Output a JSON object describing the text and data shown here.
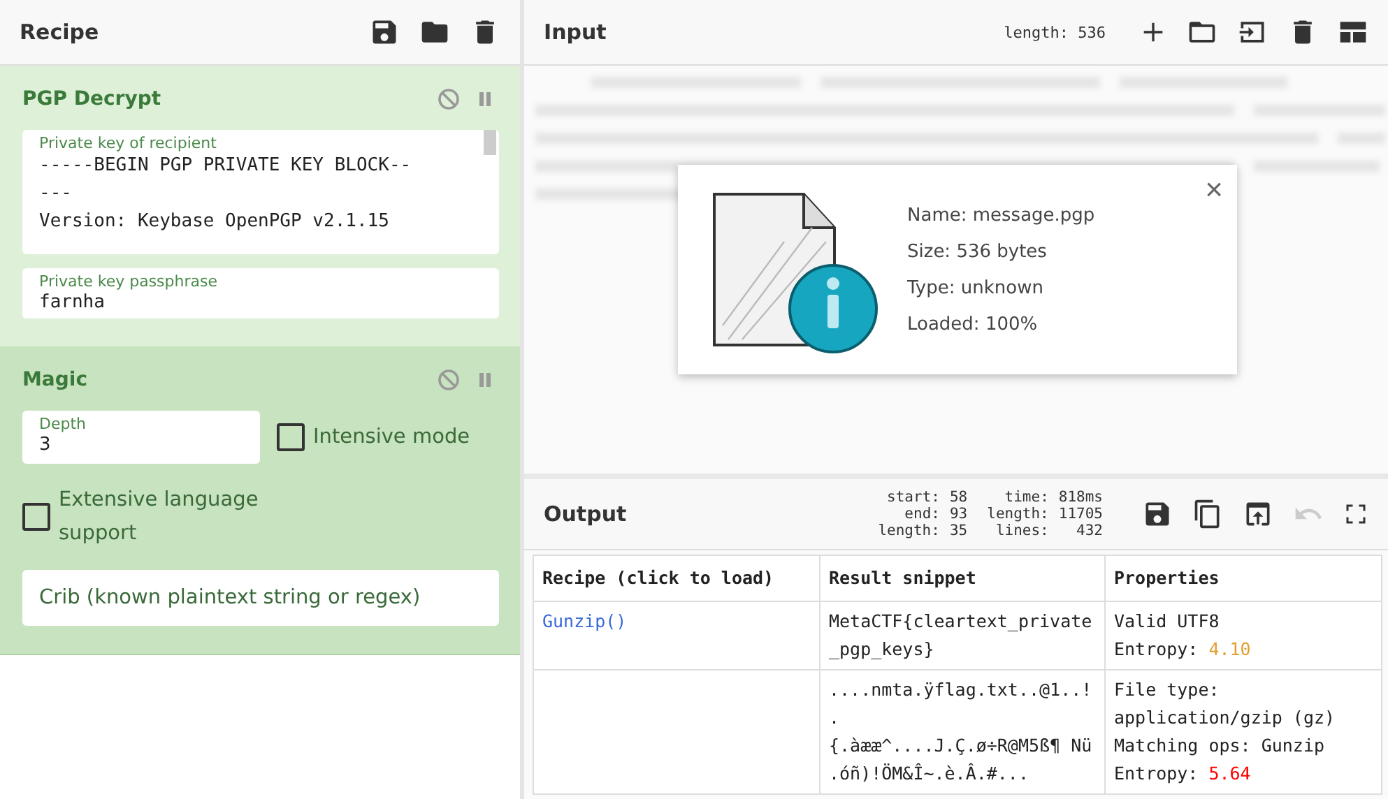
{
  "recipe": {
    "title": "Recipe",
    "operations": [
      {
        "kind": "pgp",
        "title": "PGP Decrypt",
        "disabled": false,
        "paused": false,
        "key_field": {
          "label": "Private key of recipient",
          "lines": [
            "-----BEGIN PGP PRIVATE KEY BLOCK--",
            "---",
            "Version: Keybase OpenPGP v2.1.15"
          ]
        },
        "pass_field": {
          "label": "Private key passphrase",
          "value": "farnha"
        }
      },
      {
        "kind": "magic",
        "title": "Magic",
        "disabled": false,
        "paused": false,
        "depth": {
          "label": "Depth",
          "value": "3"
        },
        "options": [
          {
            "label": "Intensive mode",
            "checked": false
          },
          {
            "label": "Extensive language support",
            "checked": false
          }
        ],
        "crib": {
          "placeholder": "Crib (known plaintext string or regex)"
        }
      }
    ]
  },
  "input": {
    "title": "Input",
    "length": "length: 536",
    "file_info": {
      "lines": [
        "Name: message.pgp",
        "Size: 536 bytes",
        "Type: unknown",
        "Loaded: 100%"
      ],
      "close": "×"
    }
  },
  "output": {
    "title": "Output",
    "stats": [
      [
        {
          "label": "start:",
          "value": "58"
        },
        {
          "label": "end:",
          "value": "93"
        },
        {
          "label": "length:",
          "value": "35"
        }
      ],
      [
        {
          "label": "time:",
          "value": "818ms"
        },
        {
          "label": "length:",
          "value": "11705"
        },
        {
          "label": "lines:",
          "value": "432"
        }
      ]
    ],
    "table": {
      "columns": [
        "Recipe (click to load)",
        "Result snippet",
        "Properties"
      ],
      "rows": [
        {
          "recipe": "Gunzip()",
          "snippet": [
            "MetaCTF{cleartext_private",
            "_pgp_keys}"
          ],
          "properties": [
            {
              "text": "Valid UTF8"
            },
            {
              "text": "Entropy: ",
              "value": "4.10",
              "color": "#e0a030"
            }
          ]
        },
        {
          "snippet": [
            "....nmta.ÿflag.txt..@1..!",
            ".",
            "{.àææ^....J.Ç.ø÷R@M5ß¶ Nü",
            ".óñ)!ÖM&Î~.è.Â.#..."
          ],
          "properties": [
            {
              "text": "File type:"
            },
            {
              "text": "application/gzip (gz)"
            },
            {
              "text": "Matching ops: Gunzip"
            },
            {
              "text": "Entropy: ",
              "value": "5.64",
              "color": "#ff0000"
            }
          ]
        }
      ]
    }
  }
}
